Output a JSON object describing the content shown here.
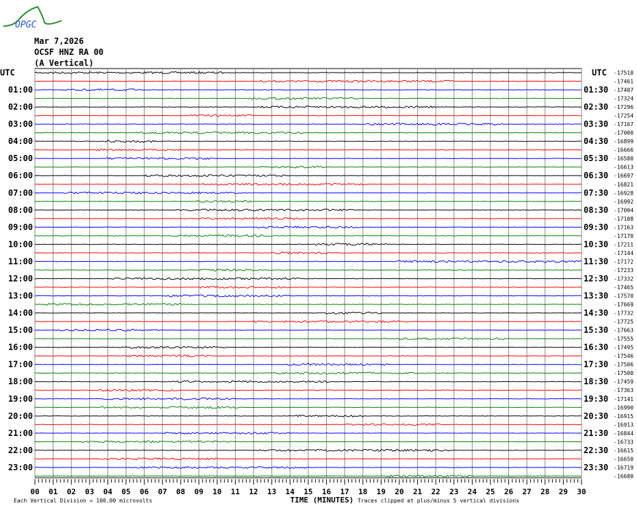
{
  "header": {
    "logo_text": "OPGC",
    "date": "Mar 7,2026",
    "station": "OCSF HNZ RA 00",
    "component": "(A Vertical)"
  },
  "chart_data": {
    "type": "helicorder",
    "title": "OCSF HNZ RA 00 (A Vertical)",
    "date": "Mar 7,2026",
    "left_axis_title": "UTC",
    "right_axis_title": "UTC",
    "xlabel": "TIME (MINUTES)",
    "xlim": [
      0,
      30
    ],
    "x_ticks": [
      "00",
      "01",
      "02",
      "03",
      "04",
      "05",
      "06",
      "07",
      "08",
      "09",
      "10",
      "11",
      "12",
      "13",
      "14",
      "15",
      "16",
      "17",
      "18",
      "19",
      "20",
      "21",
      "22",
      "23",
      "24",
      "25",
      "26",
      "27",
      "28",
      "29",
      "30"
    ],
    "left_hour_labels": [
      "01:00",
      "02:00",
      "03:00",
      "04:00",
      "05:00",
      "06:00",
      "07:00",
      "08:00",
      "09:00",
      "10:00",
      "11:00",
      "12:00",
      "13:00",
      "14:00",
      "15:00",
      "16:00",
      "17:00",
      "18:00",
      "19:00",
      "20:00",
      "21:00",
      "22:00",
      "23:00"
    ],
    "right_hour_labels": [
      "01:30",
      "02:30",
      "03:30",
      "04:30",
      "05:30",
      "06:30",
      "07:30",
      "08:30",
      "09:30",
      "10:30",
      "11:30",
      "12:30",
      "13:30",
      "14:30",
      "15:30",
      "16:30",
      "17:30",
      "18:30",
      "19:30",
      "20:30",
      "21:30",
      "22:30",
      "23:30"
    ],
    "trace_offsets": [
      "-17510",
      "-17461",
      "-17407",
      "-17324",
      "-17296",
      "-17254",
      "-17167",
      "-17000",
      "-16899",
      "-16666",
      "-16580",
      "-16613",
      "-16697",
      "-16821",
      "-16928",
      "-16992",
      "-17004",
      "-17108",
      "-17163",
      "-17170",
      "-17211",
      "-17144",
      "-17172",
      "-17233",
      "-17332",
      "-17465",
      "-17570",
      "-17669",
      "-17732",
      "-17725",
      "-17663",
      "-17555",
      "-17495",
      "-17546",
      "-17506",
      "-17500",
      "-17459",
      "-17363",
      "-17141",
      "-16990",
      "-16915",
      "-16913",
      "-16844",
      "-16733",
      "-16615",
      "-16650",
      "-16719",
      "-16680"
    ],
    "trace_colors": [
      "#000000",
      "#ff0000",
      "#0000ff",
      "#008000"
    ],
    "scale_note": "Each Vertical Division =  100.00 microvolts",
    "clip_note": "Traces clipped at plus/minus 5 vertical divisions"
  }
}
